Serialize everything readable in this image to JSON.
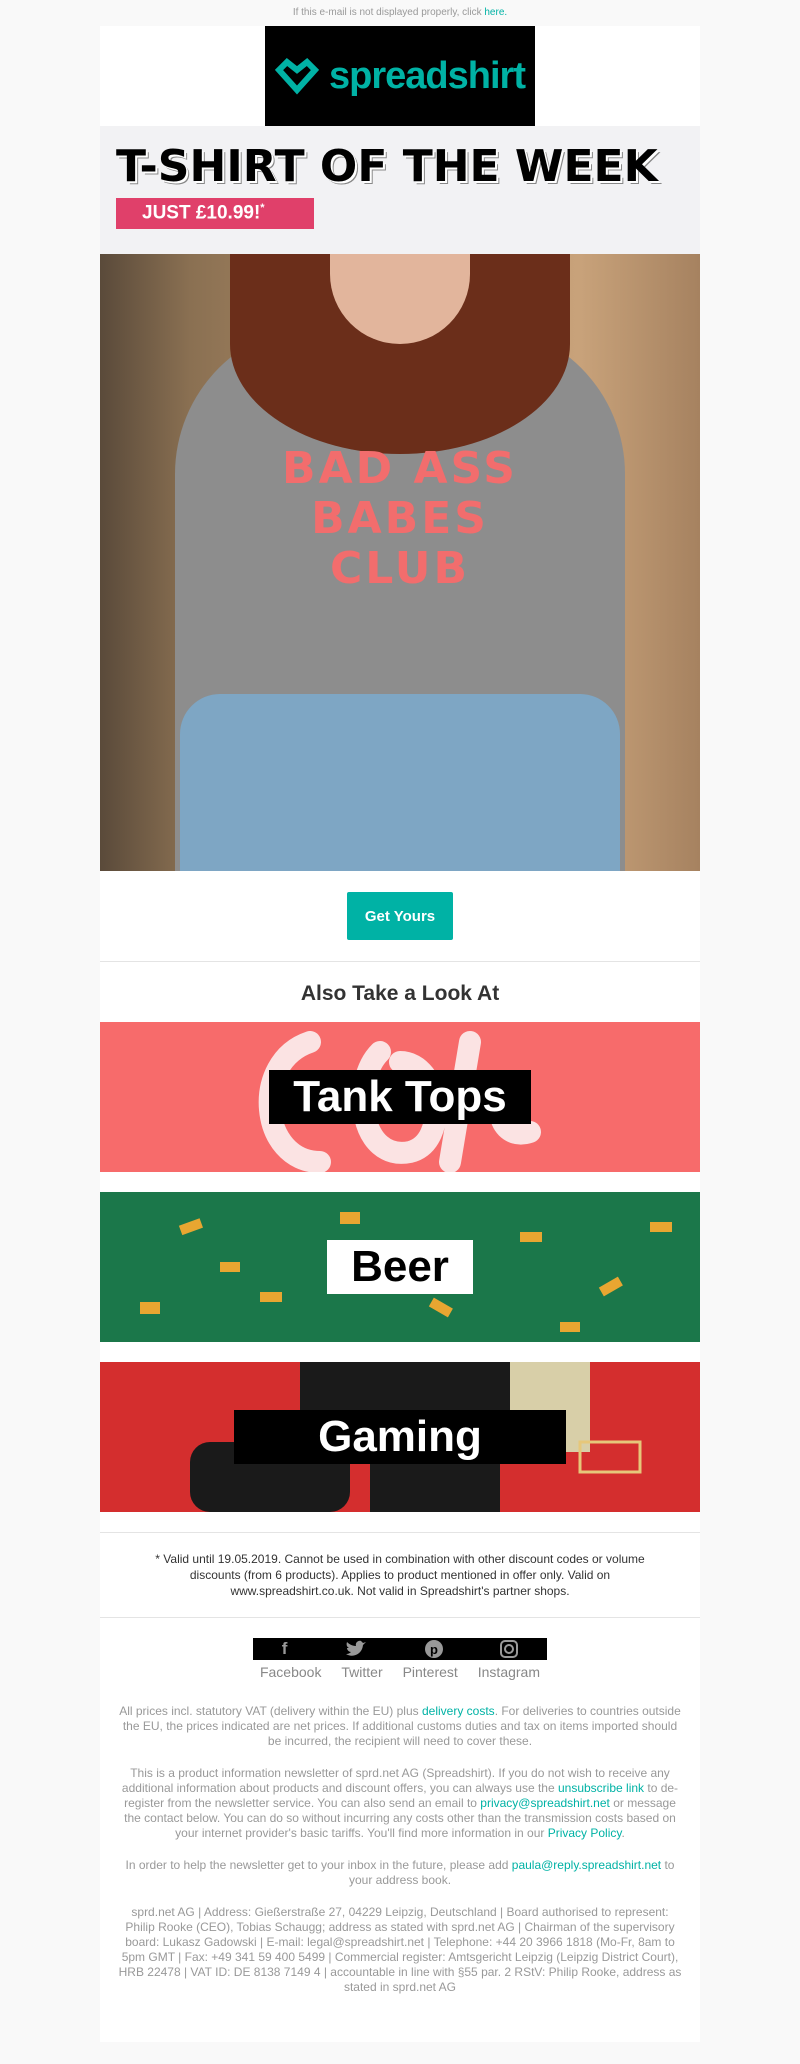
{
  "preheader": {
    "text": "If this e-mail is not displayed properly, click ",
    "link": "here."
  },
  "logo": {
    "text": "spreadshirt",
    "brand_color": "#00b2a5"
  },
  "hero": {
    "title": "T-SHIRT OF THE WEEK",
    "price": "JUST £10.99!",
    "price_mark": "*",
    "shirt_print": [
      "BAD ASS",
      "BABES",
      "CLUB"
    ],
    "button": "Get Yours"
  },
  "also": {
    "heading": "Also Take a Look At",
    "banners": [
      {
        "label": "Tank Tops",
        "bg": "#f76b6b"
      },
      {
        "label": "Beer",
        "bg": "#1b774a"
      },
      {
        "label": "Gaming",
        "bg": "#d42e2e"
      }
    ]
  },
  "disclaimer": "* Valid until 19.05.2019. Cannot be used in combination with other discount codes or volume discounts (from 6 products). Applies to product mentioned in offer only. Valid on www.spreadshirt.co.uk. Not valid in Spreadshirt's partner shops.",
  "social": [
    {
      "label": "Facebook",
      "icon": "facebook-icon"
    },
    {
      "label": "Twitter",
      "icon": "twitter-icon"
    },
    {
      "label": "Pinterest",
      "icon": "pinterest-icon"
    },
    {
      "label": "Instagram",
      "icon": "instagram-icon"
    }
  ],
  "footer": {
    "p1a": "All prices incl. statutory VAT (delivery within the EU) plus ",
    "p1link": "delivery costs",
    "p1b": ". For deliveries to countries outside the EU, the prices indicated are net prices. If additional customs duties and tax on items imported should be incurred, the recipient will need to cover these.",
    "p2a": "This is a product information newsletter of sprd.net AG (Spreadshirt). If you do not wish to receive any additional information about products and discount offers, you can always use the ",
    "p2link1": "unsubscribe link",
    "p2b": " to de-register from the newsletter service. You can also send an email to ",
    "p2link2": "privacy@spreadshirt.net",
    "p2c": " or message the contact below. You can do so without incurring any costs other than the transmission costs based on your internet provider's basic tariffs. You'll find more information in our ",
    "p2link3": "Privacy Policy",
    "p2d": ".",
    "p3a": "In order to help the newsletter get to your inbox in the future, please add ",
    "p3link": "paula@reply.spreadshirt.net",
    "p3b": " to your address book.",
    "p4": "sprd.net AG | Address: Gießerstraße 27, 04229 Leipzig, Deutschland | Board authorised to represent: Philip Rooke (CEO), Tobias Schaugg; address as stated with sprd.net AG | Chairman of the supervisory board: Lukasz Gadowski | E-mail: legal@spreadshirt.net | Telephone: +44 20 3966 1818 (Mo-Fr, 8am to 5pm GMT | Fax: +49 341 59 400 5499 | Commercial register: Amtsgericht Leipzig (Leipzig District Court), HRB 22478 | VAT ID: DE 8138 7149 4 | accountable in line with §55 par. 2 RStV: Philip Rooke, address as stated in sprd.net AG"
  }
}
